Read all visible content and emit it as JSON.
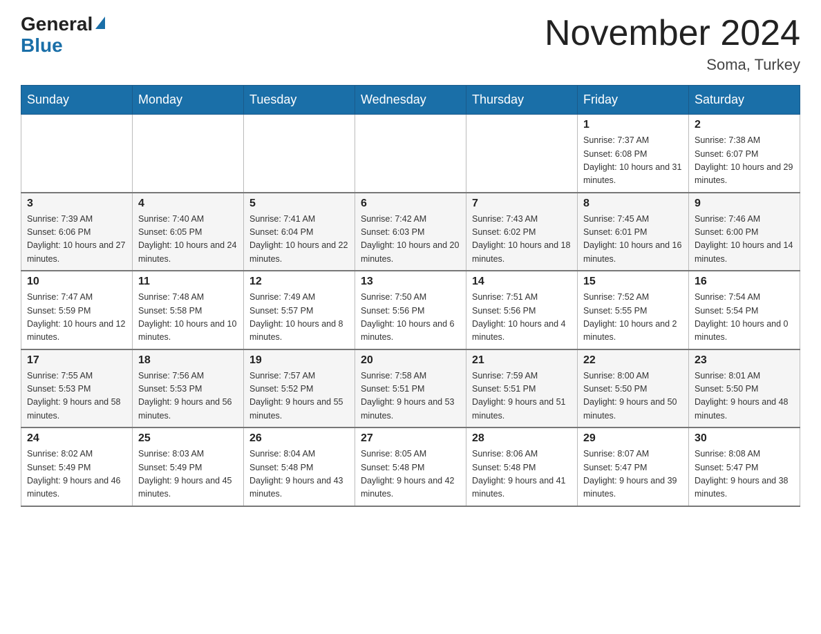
{
  "header": {
    "logo_general": "General",
    "logo_blue": "Blue",
    "month_title": "November 2024",
    "location": "Soma, Turkey"
  },
  "days_of_week": [
    "Sunday",
    "Monday",
    "Tuesday",
    "Wednesday",
    "Thursday",
    "Friday",
    "Saturday"
  ],
  "weeks": [
    {
      "days": [
        {
          "date": "",
          "sunrise": "",
          "sunset": "",
          "daylight": ""
        },
        {
          "date": "",
          "sunrise": "",
          "sunset": "",
          "daylight": ""
        },
        {
          "date": "",
          "sunrise": "",
          "sunset": "",
          "daylight": ""
        },
        {
          "date": "",
          "sunrise": "",
          "sunset": "",
          "daylight": ""
        },
        {
          "date": "",
          "sunrise": "",
          "sunset": "",
          "daylight": ""
        },
        {
          "date": "1",
          "sunrise": "Sunrise: 7:37 AM",
          "sunset": "Sunset: 6:08 PM",
          "daylight": "Daylight: 10 hours and 31 minutes."
        },
        {
          "date": "2",
          "sunrise": "Sunrise: 7:38 AM",
          "sunset": "Sunset: 6:07 PM",
          "daylight": "Daylight: 10 hours and 29 minutes."
        }
      ]
    },
    {
      "days": [
        {
          "date": "3",
          "sunrise": "Sunrise: 7:39 AM",
          "sunset": "Sunset: 6:06 PM",
          "daylight": "Daylight: 10 hours and 27 minutes."
        },
        {
          "date": "4",
          "sunrise": "Sunrise: 7:40 AM",
          "sunset": "Sunset: 6:05 PM",
          "daylight": "Daylight: 10 hours and 24 minutes."
        },
        {
          "date": "5",
          "sunrise": "Sunrise: 7:41 AM",
          "sunset": "Sunset: 6:04 PM",
          "daylight": "Daylight: 10 hours and 22 minutes."
        },
        {
          "date": "6",
          "sunrise": "Sunrise: 7:42 AM",
          "sunset": "Sunset: 6:03 PM",
          "daylight": "Daylight: 10 hours and 20 minutes."
        },
        {
          "date": "7",
          "sunrise": "Sunrise: 7:43 AM",
          "sunset": "Sunset: 6:02 PM",
          "daylight": "Daylight: 10 hours and 18 minutes."
        },
        {
          "date": "8",
          "sunrise": "Sunrise: 7:45 AM",
          "sunset": "Sunset: 6:01 PM",
          "daylight": "Daylight: 10 hours and 16 minutes."
        },
        {
          "date": "9",
          "sunrise": "Sunrise: 7:46 AM",
          "sunset": "Sunset: 6:00 PM",
          "daylight": "Daylight: 10 hours and 14 minutes."
        }
      ]
    },
    {
      "days": [
        {
          "date": "10",
          "sunrise": "Sunrise: 7:47 AM",
          "sunset": "Sunset: 5:59 PM",
          "daylight": "Daylight: 10 hours and 12 minutes."
        },
        {
          "date": "11",
          "sunrise": "Sunrise: 7:48 AM",
          "sunset": "Sunset: 5:58 PM",
          "daylight": "Daylight: 10 hours and 10 minutes."
        },
        {
          "date": "12",
          "sunrise": "Sunrise: 7:49 AM",
          "sunset": "Sunset: 5:57 PM",
          "daylight": "Daylight: 10 hours and 8 minutes."
        },
        {
          "date": "13",
          "sunrise": "Sunrise: 7:50 AM",
          "sunset": "Sunset: 5:56 PM",
          "daylight": "Daylight: 10 hours and 6 minutes."
        },
        {
          "date": "14",
          "sunrise": "Sunrise: 7:51 AM",
          "sunset": "Sunset: 5:56 PM",
          "daylight": "Daylight: 10 hours and 4 minutes."
        },
        {
          "date": "15",
          "sunrise": "Sunrise: 7:52 AM",
          "sunset": "Sunset: 5:55 PM",
          "daylight": "Daylight: 10 hours and 2 minutes."
        },
        {
          "date": "16",
          "sunrise": "Sunrise: 7:54 AM",
          "sunset": "Sunset: 5:54 PM",
          "daylight": "Daylight: 10 hours and 0 minutes."
        }
      ]
    },
    {
      "days": [
        {
          "date": "17",
          "sunrise": "Sunrise: 7:55 AM",
          "sunset": "Sunset: 5:53 PM",
          "daylight": "Daylight: 9 hours and 58 minutes."
        },
        {
          "date": "18",
          "sunrise": "Sunrise: 7:56 AM",
          "sunset": "Sunset: 5:53 PM",
          "daylight": "Daylight: 9 hours and 56 minutes."
        },
        {
          "date": "19",
          "sunrise": "Sunrise: 7:57 AM",
          "sunset": "Sunset: 5:52 PM",
          "daylight": "Daylight: 9 hours and 55 minutes."
        },
        {
          "date": "20",
          "sunrise": "Sunrise: 7:58 AM",
          "sunset": "Sunset: 5:51 PM",
          "daylight": "Daylight: 9 hours and 53 minutes."
        },
        {
          "date": "21",
          "sunrise": "Sunrise: 7:59 AM",
          "sunset": "Sunset: 5:51 PM",
          "daylight": "Daylight: 9 hours and 51 minutes."
        },
        {
          "date": "22",
          "sunrise": "Sunrise: 8:00 AM",
          "sunset": "Sunset: 5:50 PM",
          "daylight": "Daylight: 9 hours and 50 minutes."
        },
        {
          "date": "23",
          "sunrise": "Sunrise: 8:01 AM",
          "sunset": "Sunset: 5:50 PM",
          "daylight": "Daylight: 9 hours and 48 minutes."
        }
      ]
    },
    {
      "days": [
        {
          "date": "24",
          "sunrise": "Sunrise: 8:02 AM",
          "sunset": "Sunset: 5:49 PM",
          "daylight": "Daylight: 9 hours and 46 minutes."
        },
        {
          "date": "25",
          "sunrise": "Sunrise: 8:03 AM",
          "sunset": "Sunset: 5:49 PM",
          "daylight": "Daylight: 9 hours and 45 minutes."
        },
        {
          "date": "26",
          "sunrise": "Sunrise: 8:04 AM",
          "sunset": "Sunset: 5:48 PM",
          "daylight": "Daylight: 9 hours and 43 minutes."
        },
        {
          "date": "27",
          "sunrise": "Sunrise: 8:05 AM",
          "sunset": "Sunset: 5:48 PM",
          "daylight": "Daylight: 9 hours and 42 minutes."
        },
        {
          "date": "28",
          "sunrise": "Sunrise: 8:06 AM",
          "sunset": "Sunset: 5:48 PM",
          "daylight": "Daylight: 9 hours and 41 minutes."
        },
        {
          "date": "29",
          "sunrise": "Sunrise: 8:07 AM",
          "sunset": "Sunset: 5:47 PM",
          "daylight": "Daylight: 9 hours and 39 minutes."
        },
        {
          "date": "30",
          "sunrise": "Sunrise: 8:08 AM",
          "sunset": "Sunset: 5:47 PM",
          "daylight": "Daylight: 9 hours and 38 minutes."
        }
      ]
    }
  ]
}
